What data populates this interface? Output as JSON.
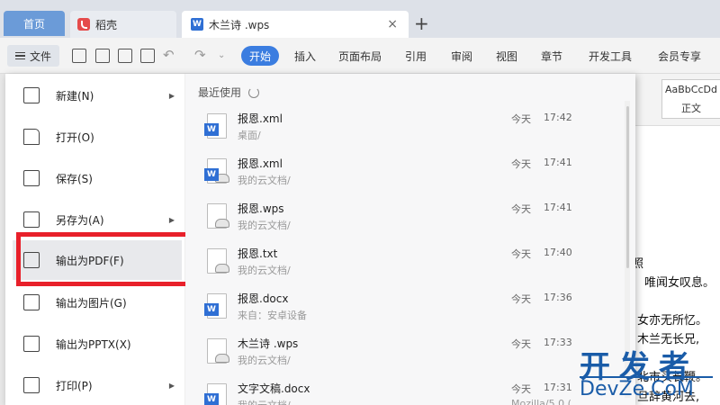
{
  "tabs": {
    "home": "首页",
    "daoke": "稻壳",
    "doc": "木兰诗 .wps",
    "close": "×",
    "new": "+"
  },
  "ribbon": {
    "file": "文件",
    "tabs": [
      "开始",
      "插入",
      "页面布局",
      "引用",
      "审阅",
      "视图",
      "章节",
      "开发工具",
      "会员专享"
    ]
  },
  "filemenu": {
    "items": [
      {
        "label": "新建(N)",
        "icon": "new-icon",
        "arrow": true
      },
      {
        "label": "打开(O)",
        "icon": "folder-icon",
        "arrow": false
      },
      {
        "label": "保存(S)",
        "icon": "save-icon",
        "arrow": false
      },
      {
        "label": "另存为(A)",
        "icon": "save-as-icon",
        "arrow": true
      },
      {
        "label": "输出为PDF(F)",
        "icon": "pdf-export-icon",
        "arrow": false
      },
      {
        "label": "输出为图片(G)",
        "icon": "image-export-icon",
        "arrow": false
      },
      {
        "label": "输出为PPTX(X)",
        "icon": "pptx-export-icon",
        "arrow": false
      },
      {
        "label": "打印(P)",
        "icon": "print-icon",
        "arrow": true
      }
    ],
    "arrow_glyph": "▶"
  },
  "recent": {
    "title": "最近使用",
    "files": [
      {
        "name": "报恩.xml",
        "path": "桌面/",
        "day": "今天",
        "time": "17:42",
        "type": "word"
      },
      {
        "name": "报恩.xml",
        "path": "我的云文档/",
        "day": "今天",
        "time": "17:41",
        "type": "word-cloud"
      },
      {
        "name": "报恩.wps",
        "path": "我的云文档/",
        "day": "今天",
        "time": "17:41",
        "type": "cloud"
      },
      {
        "name": "报恩.txt",
        "path": "我的云文档/",
        "day": "今天",
        "time": "17:40",
        "type": "cloud"
      },
      {
        "name": "报恩.docx",
        "path": "来自：安卓设备",
        "day": "今天",
        "time": "17:36",
        "type": "word"
      },
      {
        "name": "木兰诗 .wps",
        "path": "我的云文档/",
        "day": "今天",
        "time": "17:33",
        "type": "cloud"
      },
      {
        "name": "文字文稿.docx",
        "path": "我的云文档/",
        "day": "今天",
        "time": "17:31",
        "type": "word",
        "clip": "Mozilla/5.0 ("
      }
    ]
  },
  "document": {
    "style_sample": "AaBbCcDd",
    "style_name": "正文",
    "lines": [
      "照",
      "唯闻女叹息。",
      "女亦无所忆。",
      "木兰无长兄,",
      "北市买长鞭。",
      "旦辞黄河去,"
    ]
  },
  "watermark": {
    "cn": "开发者",
    "en": "DevZe.CoM"
  }
}
